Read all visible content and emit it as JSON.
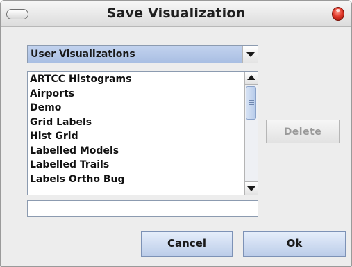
{
  "window": {
    "title": "Save Visualization",
    "controls": [
      "minimize-icon",
      "close-icon"
    ]
  },
  "combo": {
    "selected": "User Visualizations"
  },
  "list": {
    "items": [
      "ARTCC Histograms",
      "Airports",
      "Demo",
      "Grid Labels",
      "Hist Grid",
      "Labelled Models",
      "Labelled Trails",
      "Labels Ortho Bug"
    ]
  },
  "name_field": {
    "value": ""
  },
  "buttons": {
    "delete_label": "Delete",
    "cancel_mnemonic": "C",
    "cancel_rest": "ancel",
    "ok_mnemonic": "O",
    "ok_rest": "k"
  },
  "colors": {
    "combo_selection": "#b4c8e8",
    "button_gradient_top": "#e6eefb",
    "button_gradient_bottom": "#bccde9",
    "disabled_text": "#9a9a9a",
    "close_button": "#e0382a"
  }
}
